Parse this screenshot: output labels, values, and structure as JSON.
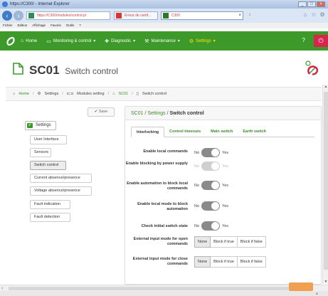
{
  "browser": {
    "title": "https://C300/ - Internet Explorer",
    "url": "https://C300/modules/control.pl",
    "tab_1": "Erreur de certif...",
    "tab_2": "C300",
    "menu": [
      "Fichier",
      "Edition",
      "Affichage",
      "Favoris",
      "Outils",
      "?"
    ]
  },
  "nav": {
    "items": [
      {
        "label": "Home",
        "icon": "home-icon"
      },
      {
        "label": "Monitoring & control",
        "icon": "monitor-icon"
      },
      {
        "label": "Diagnostic",
        "icon": "diagnostic-icon"
      },
      {
        "label": "Maintenance",
        "icon": "maintenance-icon"
      },
      {
        "label": "Settings",
        "icon": "settings-icon"
      }
    ],
    "active": "Settings"
  },
  "page": {
    "code": "SC01",
    "subtitle": "Switch control"
  },
  "breadcrumb": [
    "Home",
    "Settings",
    "Modules setting",
    "SC01",
    "Switch control"
  ],
  "sidebar": {
    "save_label": "Save",
    "root_label": "Settings",
    "items": [
      "User Interface",
      "Sensors",
      "Switch control",
      "Current absence/presence",
      "Voltage absence/presence",
      "Fault indication",
      "Fault detection"
    ],
    "selected": "Switch control"
  },
  "panel": {
    "crumbs": [
      "SC01",
      "Settings",
      "Switch control"
    ],
    "tabs": [
      "Interlocking",
      "Control timeouts",
      "Main switch",
      "Earth switch"
    ],
    "active_tab": "Interlocking",
    "fields": [
      {
        "label": "Enable local commands",
        "no": "No",
        "yes": "Yes",
        "value": "No",
        "disabled": false
      },
      {
        "label": "Enable blocking by power supply",
        "no": "No",
        "yes": "Yes",
        "value": "No",
        "disabled": true
      },
      {
        "label": "Enable automation to block local commands",
        "no": "No",
        "yes": "Yes",
        "value": "No",
        "disabled": false
      },
      {
        "label": "Enable local mode to block automation",
        "no": "No",
        "yes": "Yes",
        "value": "No",
        "disabled": false
      },
      {
        "label": "Check initial switch state",
        "no": "No",
        "yes": "Yes",
        "value": "No",
        "disabled": false
      }
    ],
    "input_modes": [
      {
        "label": "External input mode for open commands",
        "options": [
          "None",
          "Block if true",
          "Block if false"
        ],
        "selected": "None"
      },
      {
        "label": "External input mode for close commands",
        "options": [
          "None",
          "Block if true",
          "Block if false"
        ],
        "selected": "None"
      }
    ]
  },
  "colors": {
    "brand_green": "#3d9a2a",
    "active_yellow": "#ffe400",
    "logout_red": "#d8254c"
  }
}
